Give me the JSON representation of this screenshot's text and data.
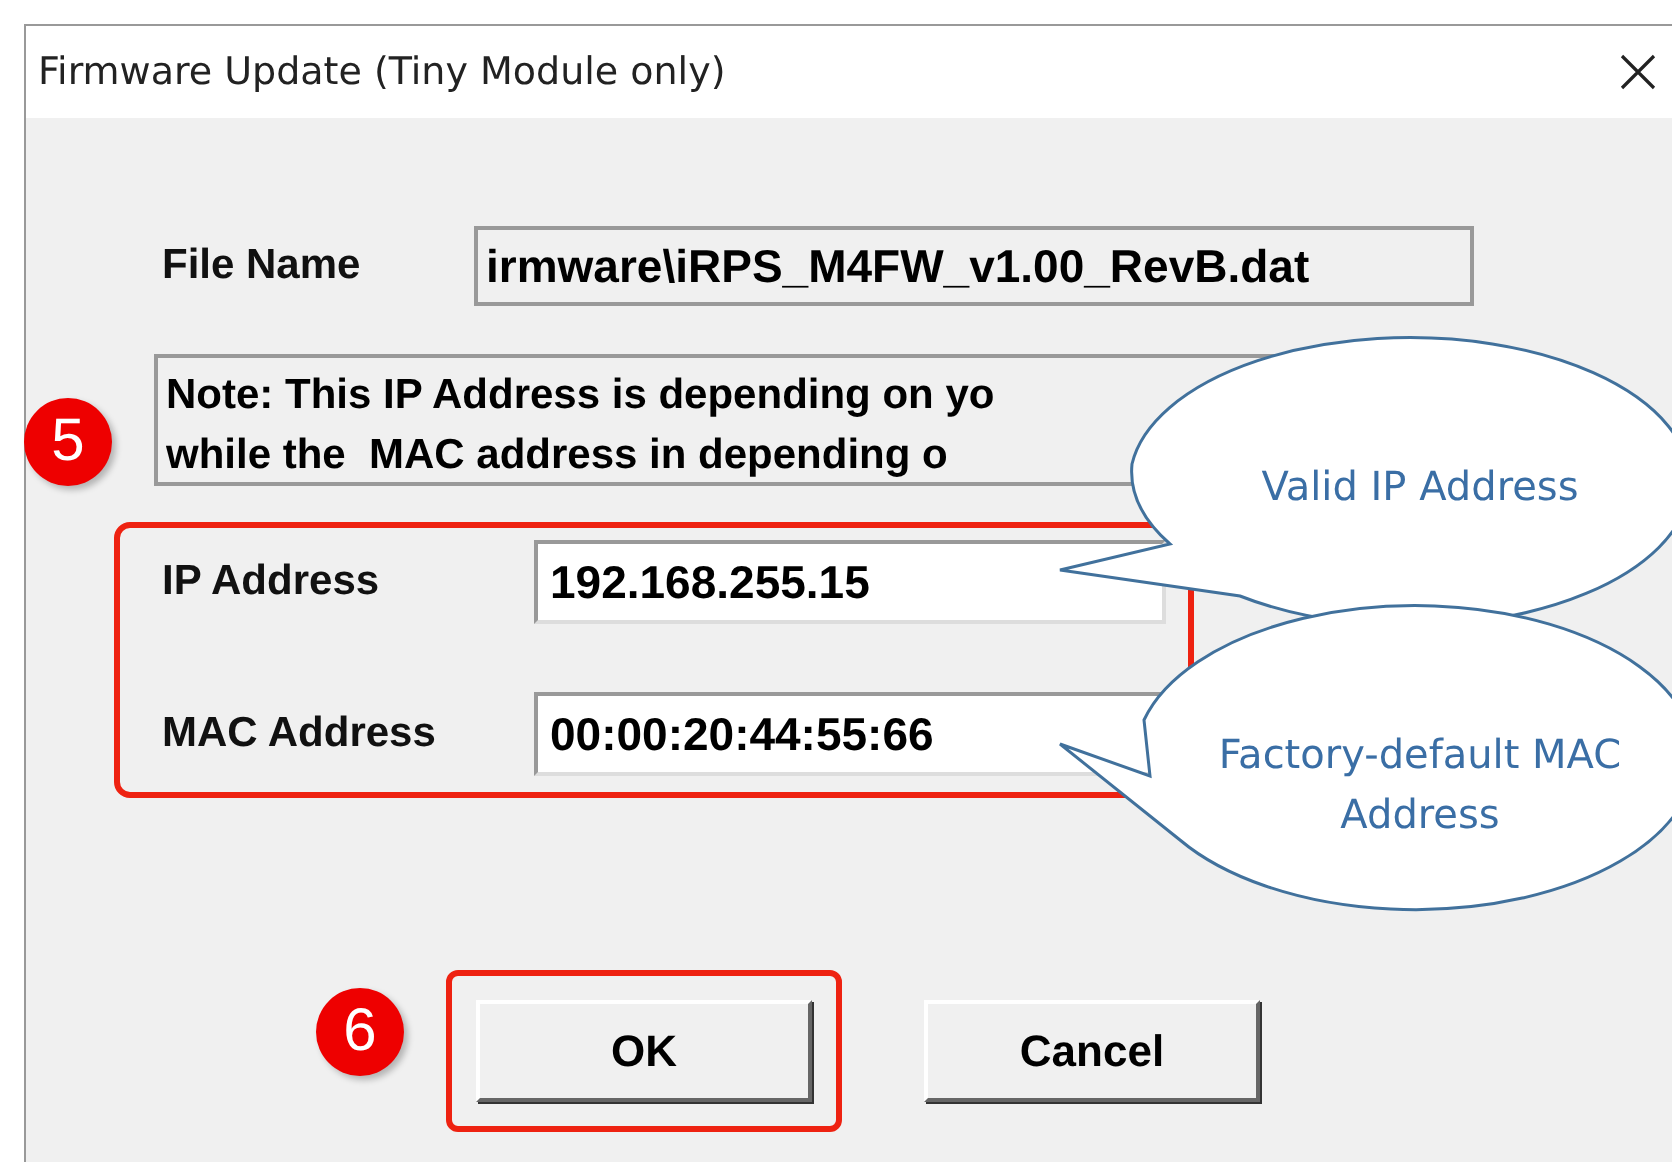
{
  "window": {
    "title": "Firmware Update (Tiny Module only)"
  },
  "file_name": {
    "label": "File Name",
    "value": "irmware\\iRPS_M4FW_v1.00_RevB.dat"
  },
  "note": {
    "lines": [
      "Note: This IP Address is depending on yo",
      "while the  MAC address in depending o"
    ]
  },
  "fields": [
    {
      "label": "IP Address",
      "value": "192.168.255.15"
    },
    {
      "label": "MAC Address",
      "value": "00:00:20:44:55:66"
    }
  ],
  "buttons": [
    {
      "label": "OK",
      "highlighted": true
    },
    {
      "label": "Cancel",
      "highlighted": false
    }
  ],
  "steps": [
    {
      "number": "5"
    },
    {
      "number": "6"
    }
  ],
  "callouts": [
    {
      "text": "Valid IP Address"
    },
    {
      "text": "Factory-default MAC Address"
    }
  ]
}
